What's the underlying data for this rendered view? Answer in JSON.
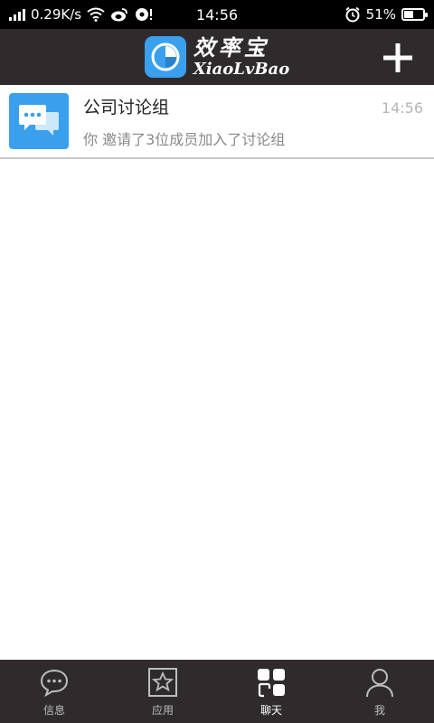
{
  "status_bar": {
    "network_speed": "0.29K/s",
    "time": "14:56",
    "battery_percent": "51%",
    "battery_level": 0.51
  },
  "header": {
    "logo_cn": "效率宝",
    "logo_en": "XiaoLvBao",
    "add_label": "+"
  },
  "conversations": [
    {
      "title": "公司讨论组",
      "preview": "你 邀请了3位成员加入了讨论组",
      "time": "14:56"
    }
  ],
  "tabs": [
    {
      "label": "信息",
      "icon": "chat-bubble-icon",
      "active": false
    },
    {
      "label": "应用",
      "icon": "star-app-icon",
      "active": false
    },
    {
      "label": "聊天",
      "icon": "grid-chat-icon",
      "active": true
    },
    {
      "label": "我",
      "icon": "person-icon",
      "active": false
    }
  ],
  "colors": {
    "header_bg": "#2f2b2c",
    "accent": "#3aa0ee",
    "status_bg": "#000000"
  }
}
